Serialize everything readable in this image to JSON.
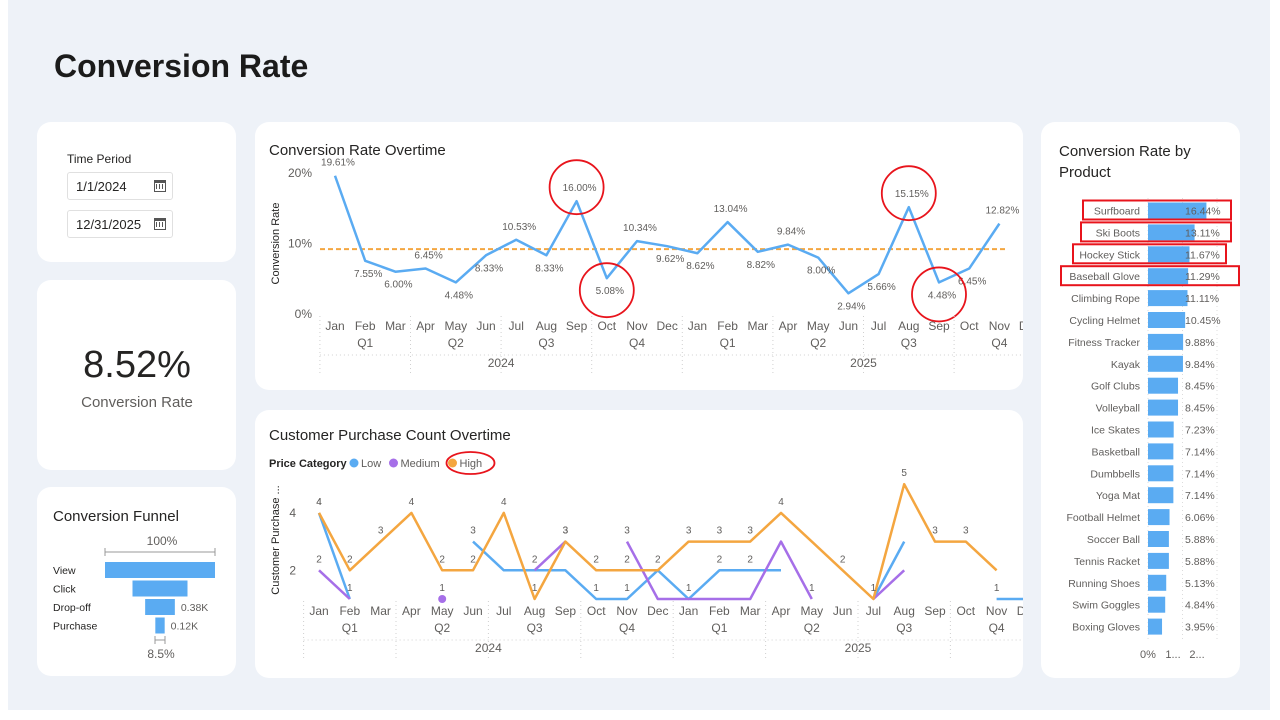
{
  "page": {
    "title": "Conversion Rate"
  },
  "filters": {
    "label": "Time Period",
    "start": "1/1/2024",
    "end": "12/31/2025"
  },
  "kpi": {
    "value": "8.52%",
    "label": "Conversion Rate"
  },
  "funnel": {
    "title": "Conversion Funnel",
    "top_label": "100%",
    "bottom_label": "8.5%",
    "stages": [
      {
        "name": "View",
        "rel": 1.0,
        "label": ""
      },
      {
        "name": "Click",
        "rel": 0.5,
        "label": ""
      },
      {
        "name": "Drop-off",
        "rel": 0.27,
        "label": "0.38K"
      },
      {
        "name": "Purchase",
        "rel": 0.085,
        "label": "0.12K"
      }
    ]
  },
  "highlight_color": "#e8141c",
  "chart_data": [
    {
      "type": "line",
      "title": "Conversion Rate Overtime",
      "ylabel": "Conversion Rate",
      "xlabel": "",
      "ylim": [
        0,
        20
      ],
      "yticks": [
        "0%",
        "10%",
        "20%"
      ],
      "color": "#5aabf2",
      "reference_line": {
        "value": 9.2,
        "color": "#f4a640",
        "style": "dashed"
      },
      "months": [
        "Jan",
        "Feb",
        "Mar",
        "Apr",
        "May",
        "Jun",
        "Jul",
        "Aug",
        "Sep",
        "Oct",
        "Nov",
        "Dec",
        "Jan",
        "Feb",
        "Mar",
        "Apr",
        "May",
        "Jun",
        "Jul",
        "Aug",
        "Sep",
        "Oct",
        "Nov",
        "Dec"
      ],
      "quarters": [
        "Q1",
        "Q2",
        "Q3",
        "Q4",
        "Q1",
        "Q2",
        "Q3",
        "Q4"
      ],
      "years": [
        "2024",
        "2025"
      ],
      "values": [
        19.61,
        7.55,
        6.0,
        6.45,
        4.48,
        8.33,
        10.53,
        8.33,
        16.0,
        5.08,
        10.34,
        9.62,
        8.62,
        13.04,
        8.82,
        9.84,
        8.0,
        2.94,
        5.66,
        15.15,
        4.48,
        6.45,
        12.82
      ],
      "labels": [
        "19.61%",
        "7.55%",
        "6.00%",
        "6.45%",
        "4.48%",
        "8.33%",
        "10.53%",
        "8.33%",
        "16.00%",
        "5.08%",
        "10.34%",
        "9.62%",
        "8.62%",
        "13.04%",
        "8.82%",
        "9.84%",
        "8.00%",
        "2.94%",
        "5.66%",
        "15.15%",
        "4.48%",
        "6.45%",
        "12.82%"
      ],
      "circled": [
        8,
        9,
        19,
        20
      ]
    },
    {
      "type": "line",
      "title": "Customer Purchase Count Overtime",
      "ylabel": "Customer Purchase ...",
      "legend_title": "Price Category",
      "legend_position": "top-left",
      "ylim": [
        0,
        5
      ],
      "yticks": [
        {
          "v": 2,
          "t": "2"
        },
        {
          "v": 4,
          "t": "4"
        }
      ],
      "series": [
        {
          "name": "Low",
          "color": "#5aabf2",
          "values": [
            4,
            1,
            null,
            null,
            null,
            3,
            2,
            2,
            2,
            1,
            1,
            2,
            1,
            2,
            2,
            2,
            null,
            null,
            1,
            3,
            null,
            null,
            1,
            1
          ]
        },
        {
          "name": "Medium",
          "color": "#a66fe8",
          "values": [
            2,
            1,
            null,
            null,
            1,
            null,
            null,
            2,
            3,
            null,
            3,
            1,
            1,
            1,
            1,
            3,
            1,
            null,
            1,
            2,
            null,
            null,
            null,
            2
          ]
        },
        {
          "name": "High",
          "color": "#f4a640",
          "values": [
            4,
            2,
            3,
            4,
            2,
            2,
            4,
            1,
            3,
            2,
            2,
            2,
            3,
            3,
            3,
            4,
            3,
            2,
            1,
            5,
            3,
            3,
            2,
            null
          ]
        }
      ],
      "value_labels": [
        [
          "4",
          "1",
          "",
          "",
          "",
          "3",
          "",
          "",
          "",
          "1",
          "1",
          "",
          "1",
          "2",
          "2",
          "",
          "",
          "",
          "1",
          "",
          "",
          "",
          "1",
          "1"
        ],
        [
          "2",
          "",
          "",
          "",
          "1",
          "",
          "",
          "2",
          "3",
          "",
          "3",
          "",
          "",
          "",
          "",
          "",
          "1",
          "",
          "",
          "",
          "",
          "",
          "",
          "2"
        ],
        [
          "4",
          "2",
          "3",
          "4",
          "2",
          "2",
          "4",
          "1",
          "3",
          "2",
          "2",
          "2",
          "3",
          "3",
          "3",
          "4",
          "",
          "2",
          "",
          "5",
          "3",
          "3",
          "",
          ""
        ]
      ],
      "circled_legend": "High"
    },
    {
      "type": "bar",
      "orientation": "horizontal",
      "title": "Conversion Rate by Product",
      "color": "#5aabf2",
      "xlim": [
        0,
        20
      ],
      "xticks": [
        "0%",
        "1...",
        "2..."
      ],
      "categories": [
        "Surfboard",
        "Ski Boots",
        "Hockey Stick",
        "Baseball Glove",
        "Climbing Rope",
        "Cycling Helmet",
        "Fitness Tracker",
        "Kayak",
        "Golf Clubs",
        "Volleyball",
        "Ice Skates",
        "Basketball",
        "Dumbbells",
        "Yoga Mat",
        "Football Helmet",
        "Soccer Ball",
        "Tennis Racket",
        "Running Shoes",
        "Swim Goggles",
        "Boxing Gloves"
      ],
      "values": [
        16.44,
        13.11,
        11.67,
        11.29,
        11.11,
        10.45,
        9.88,
        9.84,
        8.45,
        8.45,
        7.23,
        7.14,
        7.14,
        7.14,
        6.06,
        5.88,
        5.88,
        5.13,
        4.84,
        3.95
      ],
      "labels": [
        "16.44%",
        "13.11%",
        "11.67%",
        "11.29%",
        "11.11%",
        "10.45%",
        "9.88%",
        "9.84%",
        "8.45%",
        "8.45%",
        "7.23%",
        "7.14%",
        "7.14%",
        "7.14%",
        "6.06%",
        "5.88%",
        "5.88%",
        "5.13%",
        "4.84%",
        "3.95%"
      ],
      "highlighted": [
        0,
        1,
        2,
        3
      ]
    }
  ]
}
